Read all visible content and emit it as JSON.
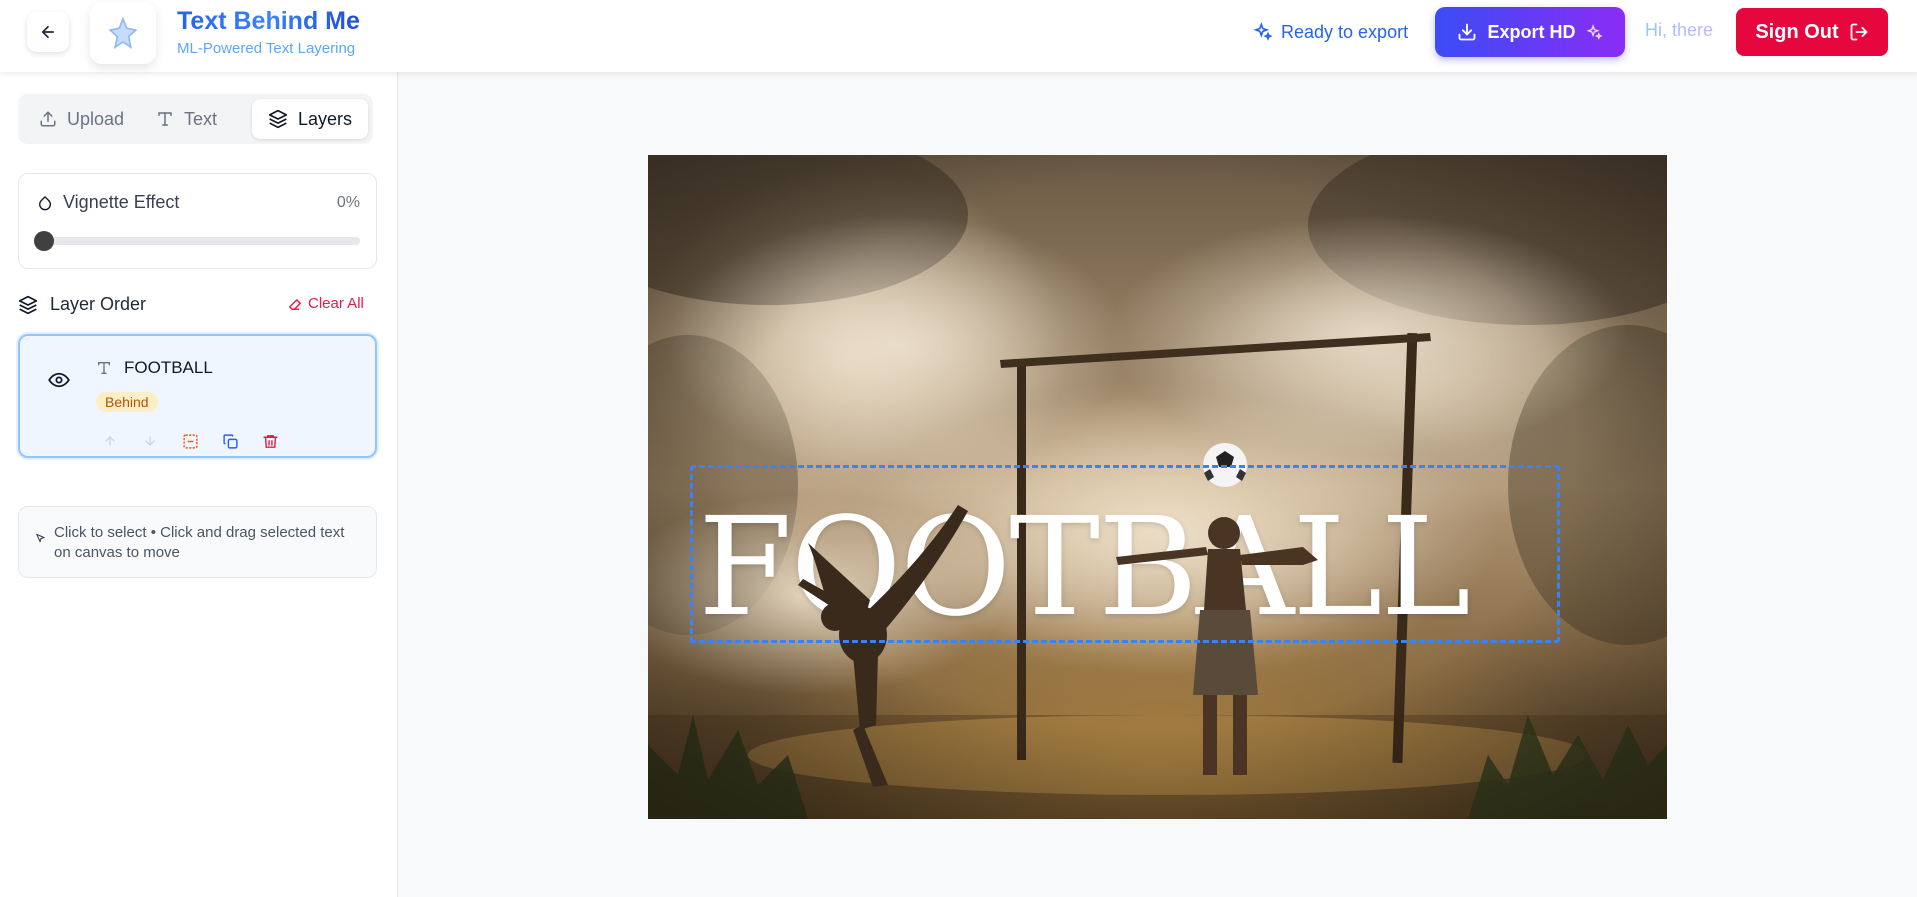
{
  "header": {
    "back_icon": "arrow-left-icon",
    "logo_icon": "sparkle-star-icon",
    "title": "Text Behind Me",
    "subtitle": "ML-Powered Text Layering",
    "status": "Ready to export",
    "export_label": "Export HD",
    "greeting": "Hi, there",
    "signout_label": "Sign Out",
    "colors": {
      "accent": "#2563eb",
      "export_from": "#3b4cf5",
      "export_to": "#8b2cf5",
      "signout": "#e6073f"
    }
  },
  "sidebar": {
    "tabs": [
      {
        "label": "Upload",
        "icon": "upload-icon",
        "active": false
      },
      {
        "label": "Text",
        "icon": "text-type-icon",
        "active": false
      },
      {
        "label": "Layers",
        "icon": "layers-icon",
        "active": true
      }
    ],
    "vignette": {
      "label": "Vignette Effect",
      "value": "0%",
      "level": 0
    },
    "layer_order_title": "Layer Order",
    "clear_all": "Clear All",
    "layers": [
      {
        "name": "FOOTBALL",
        "badge": "Behind",
        "visible": true,
        "selected": true
      }
    ],
    "hint": "Click to select • Click and drag selected text on canvas to move"
  },
  "canvas": {
    "text": "FOOTBALL",
    "text_color": "#ffffff",
    "selection_color": "#3b82f6"
  }
}
